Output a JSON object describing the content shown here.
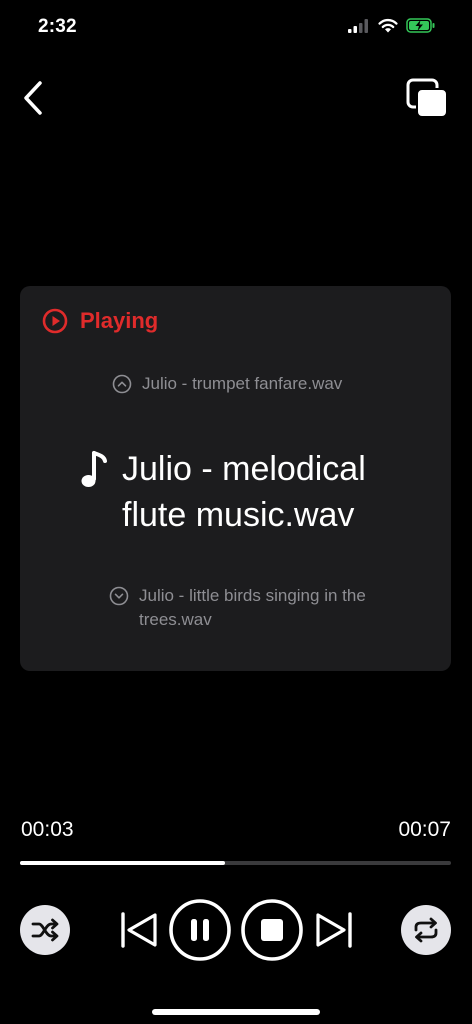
{
  "status_bar": {
    "time": "2:32"
  },
  "player": {
    "state_label": "Playing",
    "previous_track": "Julio - trumpet fanfare.wav",
    "current_track": "Julio - melodical flute music.wav",
    "next_track": "Julio - little birds singing in the trees.wav"
  },
  "progress": {
    "elapsed": "00:03",
    "total": "00:07",
    "fraction": 0.475
  },
  "icons": {
    "back": "chevron-left-icon",
    "pip": "picture-in-picture-icon",
    "playing": "play-circle-icon",
    "prev_track": "chevron-up-circle-icon",
    "current": "music-note-icon",
    "next_track": "chevron-down-circle-icon",
    "shuffle": "shuffle-icon",
    "skip_previous": "skip-previous-icon",
    "pause": "pause-icon",
    "stop": "stop-icon",
    "skip_next": "skip-next-icon",
    "repeat": "repeat-icon"
  },
  "colors": {
    "accent": "#e02b2b",
    "background": "#000000",
    "card": "#1c1c1e",
    "battery": "#34c759"
  }
}
